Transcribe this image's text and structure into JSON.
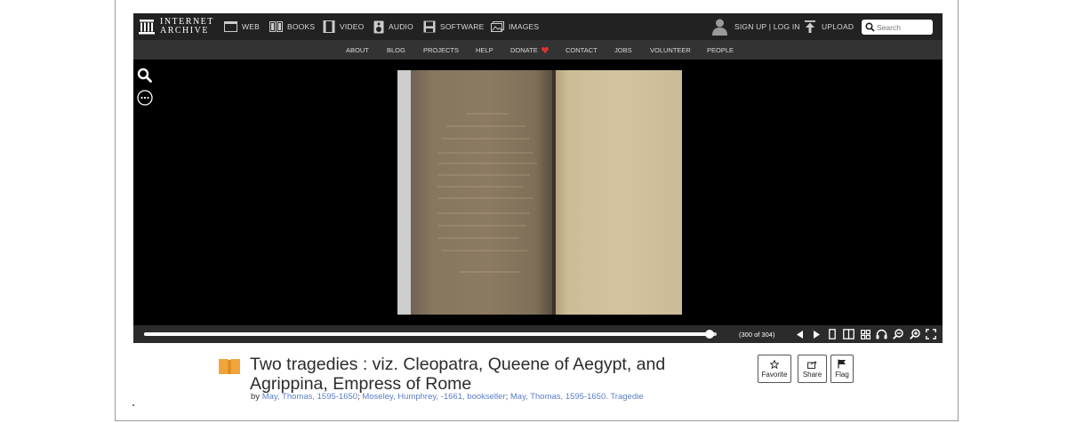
{
  "site": {
    "logo_line1": "INTERNET",
    "logo_line2": "ARCHIVE"
  },
  "topnav": {
    "items": [
      {
        "label": "WEB",
        "icon": "web-icon"
      },
      {
        "label": "BOOKS",
        "icon": "books-icon"
      },
      {
        "label": "VIDEO",
        "icon": "video-icon"
      },
      {
        "label": "AUDIO",
        "icon": "audio-icon"
      },
      {
        "label": "SOFTWARE",
        "icon": "software-icon"
      },
      {
        "label": "IMAGES",
        "icon": "images-icon"
      }
    ],
    "account": "SIGN UP | LOG IN",
    "upload": "UPLOAD",
    "search_placeholder": "Search"
  },
  "subnav": {
    "items": [
      "ABOUT",
      "BLOG",
      "PROJECTS",
      "HELP",
      "DONATE",
      "CONTACT",
      "JOBS",
      "VOLUNTEER",
      "PEOPLE"
    ]
  },
  "viewer": {
    "page_count": "(300 of 304)",
    "progress": 0.987
  },
  "item": {
    "title": "Two tragedies : viz. Cleopatra, Queene of Aegypt, and Agrippina, Empress of Rome",
    "by_label": "by",
    "creators": [
      {
        "text": "May, Thomas, 1595-1650",
        "sep": "; "
      },
      {
        "text": "Moseley, Humphrey, -1661, bookseller",
        "sep": "; "
      },
      {
        "text": "May, Thomas, 1595-1650. Tragedie",
        "sep": ""
      }
    ]
  },
  "actions": {
    "favorite": "Favorite",
    "share": "Share",
    "flag": "Flag"
  },
  "colors": {
    "topnav_bg": "#222222",
    "subnav_bg": "#333333",
    "link": "#5b7ec6",
    "donate_heart": "#e03131",
    "book_icon": "#f0a43a"
  }
}
